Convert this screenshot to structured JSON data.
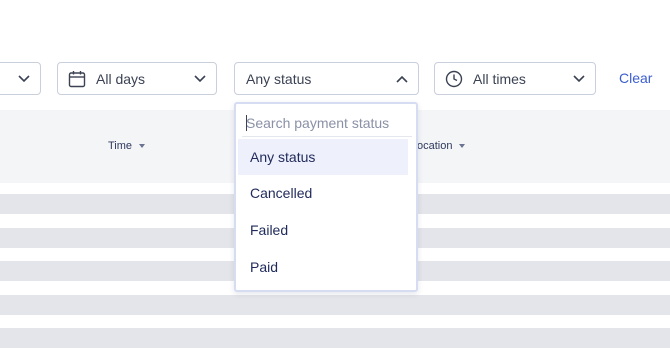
{
  "filters": {
    "days": {
      "label": "All days",
      "icon": "calendar-icon"
    },
    "status": {
      "label": "Any status",
      "icon": "chevron-up-icon"
    },
    "times": {
      "label": "All times",
      "icon": "clock-icon"
    },
    "clear_label": "Clear"
  },
  "table": {
    "columns": [
      {
        "label": "Time"
      },
      {
        "label": "ocation"
      }
    ]
  },
  "status_dropdown": {
    "search_placeholder": "Search payment status",
    "options": [
      {
        "label": "Any status",
        "selected": true
      },
      {
        "label": "Cancelled",
        "selected": false
      },
      {
        "label": "Failed",
        "selected": false
      },
      {
        "label": "Paid",
        "selected": false
      }
    ]
  },
  "colors": {
    "accent": "#3c5ecf",
    "option_text": "#1f2a5a",
    "selected_bg": "#eef0fb",
    "row_placeholder": "#e3e5ea",
    "header_bg": "#f4f5f7"
  }
}
